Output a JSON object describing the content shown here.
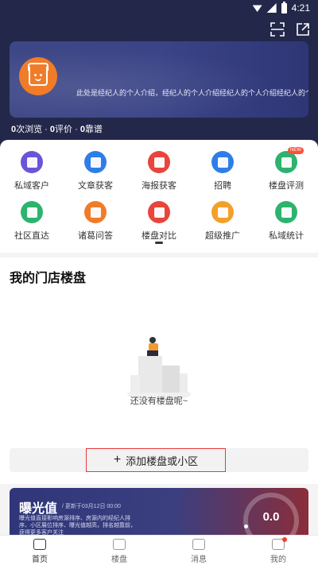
{
  "status_bar": {
    "time": "4:21"
  },
  "profile": {
    "intro": "此处是经纪人的个人介绍，经纪人的个人介绍经纪人的个人介绍经纪人的个人",
    "stats": {
      "views": "0",
      "views_label": "次浏览",
      "ratings": "0",
      "ratings_label": "评价",
      "reliable": "0",
      "reliable_label": "靠谱",
      "sep": " · "
    }
  },
  "grid": [
    {
      "label": "私域客户",
      "icon": "person-icon",
      "color": "#6a55d8"
    },
    {
      "label": "文章获客",
      "icon": "article-icon",
      "color": "#2f7ee8"
    },
    {
      "label": "海报获客",
      "icon": "poster-icon",
      "color": "#e8453b"
    },
    {
      "label": "招聘",
      "icon": "recruit-icon",
      "color": "#2f7ee8"
    },
    {
      "label": "楼盘评测",
      "icon": "building-review-icon",
      "color": "#2db36e",
      "badge": "NEW"
    },
    {
      "label": "社区直达",
      "icon": "community-icon",
      "color": "#2db36e"
    },
    {
      "label": "诸葛问答",
      "icon": "qa-icon",
      "color": "#f07c2a"
    },
    {
      "label": "楼盘对比",
      "icon": "compare-icon",
      "color": "#e8453b"
    },
    {
      "label": "超级推广",
      "icon": "promote-icon",
      "color": "#f3a02a"
    },
    {
      "label": "私域统计",
      "icon": "stats-icon",
      "color": "#2db36e"
    }
  ],
  "store": {
    "title": "我的门店楼盘",
    "empty_text": "还没有楼盘呢~",
    "add_label": "添加楼盘或小区",
    "add_plus": "+"
  },
  "exposure": {
    "title": "曝光值",
    "updated": "/ 更新于03月12日 00:00",
    "desc": "曝光值直接影响房源排序、房源内的经纪人排序、小区展位排序、曝光值越高，排名越靠前，获得更多客户关注",
    "value": "0.0"
  },
  "tabs": [
    {
      "label": "首页",
      "icon": "home-icon",
      "active": true
    },
    {
      "label": "楼盘",
      "icon": "building-icon"
    },
    {
      "label": "消息",
      "icon": "message-icon"
    },
    {
      "label": "我的",
      "icon": "profile-icon"
    }
  ],
  "colors": {
    "header_bg": "#23274a",
    "accent_red": "#e83a3a"
  }
}
